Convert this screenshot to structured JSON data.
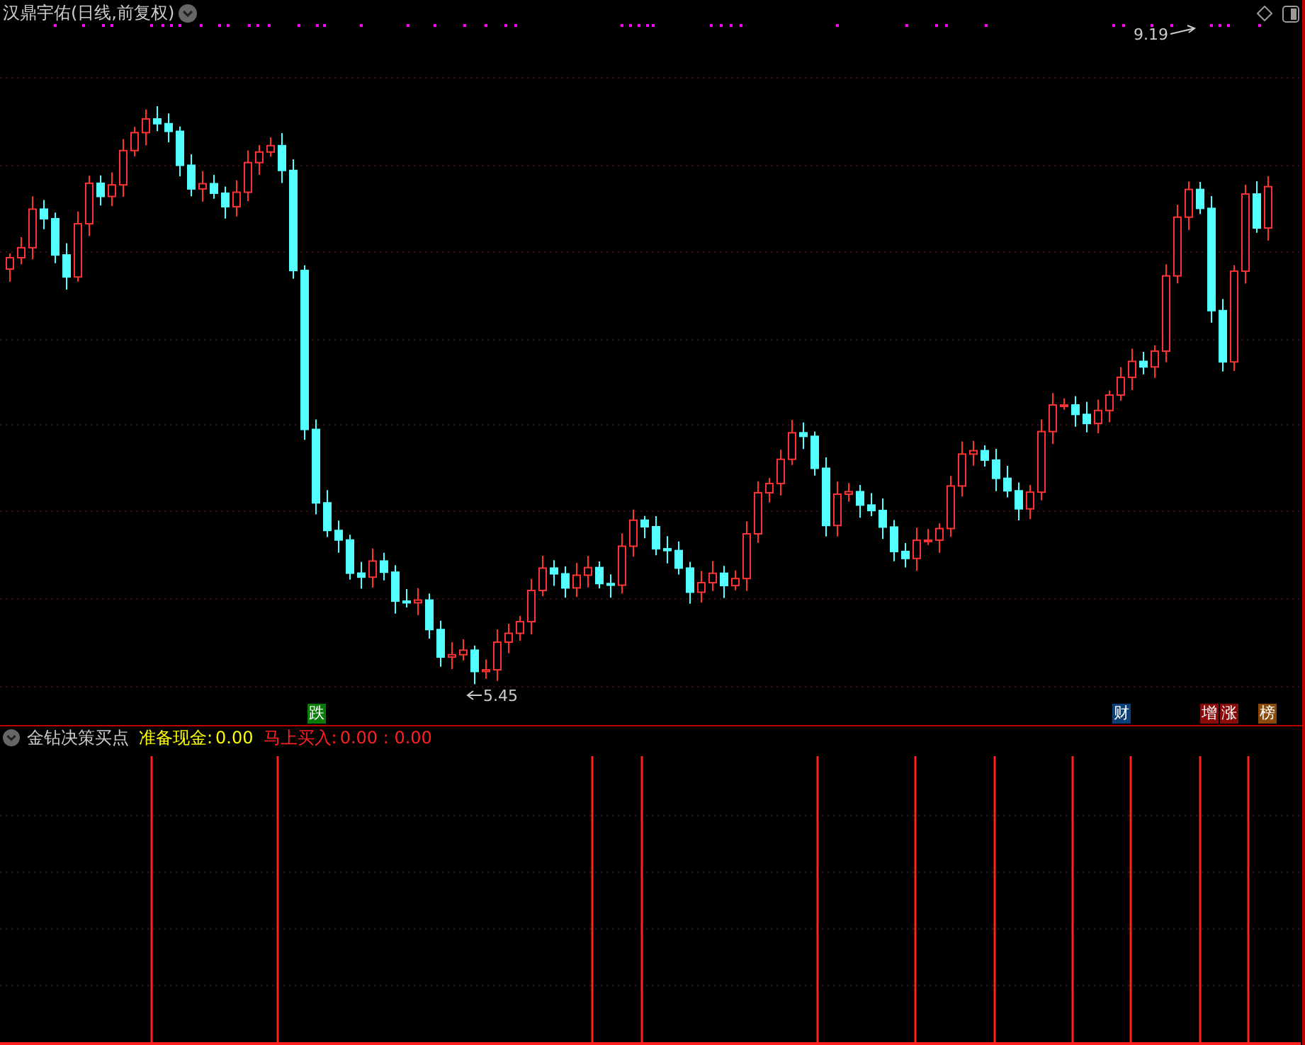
{
  "main_chart": {
    "title": "汉鼎宇佑(日线,前复权)",
    "high_label": "9.19",
    "low_label": "5.45",
    "markers": [
      {
        "text": "跌",
        "color": "#0a7a0a"
      },
      {
        "text": "财",
        "color": "#0d3f78"
      },
      {
        "text": "增",
        "color": "#8a0a0a"
      },
      {
        "text": "涨",
        "color": "#8a0a0a"
      },
      {
        "text": "榜",
        "color": "#8a4a0a"
      }
    ]
  },
  "indicator": {
    "name": "金钻决策买点",
    "items": [
      {
        "label": "准备现金:",
        "value": "0.00",
        "color": "#ffff00"
      },
      {
        "label": "马上买入:",
        "value": "0.00 : 0.00",
        "color": "#ff2020"
      }
    ]
  }
}
